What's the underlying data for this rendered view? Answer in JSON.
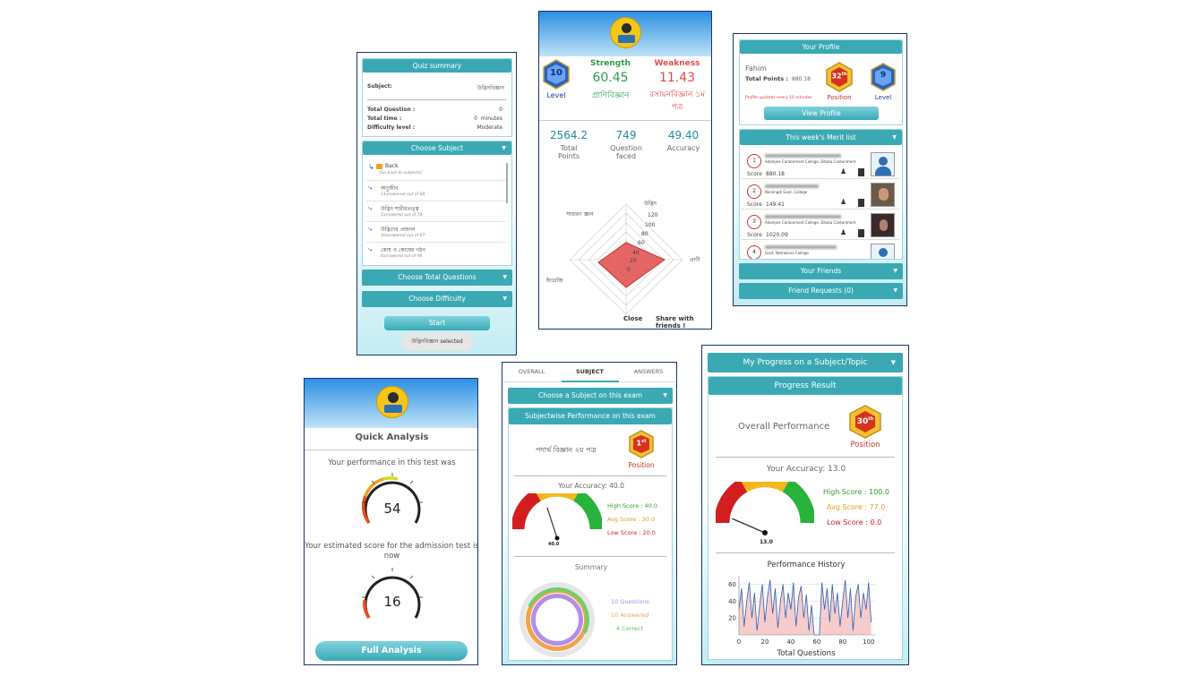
{
  "quiz": {
    "summary_title": "Quiz summary",
    "subject_label": "Subject:",
    "subject_value": "উদ্ভিদবিজ্ঞান",
    "total_question_label": "Total Question :",
    "total_question_value": "0",
    "total_time_label": "Total time :",
    "total_time_value": "0",
    "total_time_unit": "minutes",
    "difficulty_label": "Difficulty level :",
    "difficulty_value": "Moderate",
    "choose_subject": "Choose Subject",
    "topics": [
      {
        "name": "Back",
        "sub": "[Go back to subjects]"
      },
      {
        "name": "অণুজীব",
        "sub": "11answered out of 68"
      },
      {
        "name": "উদ্ভিদ শারীরতত্ত্ব",
        "sub": "5answered out of 74"
      },
      {
        "name": "উদ্ভিদের প্রজনন",
        "sub": "10answered out of 67"
      },
      {
        "name": "কোষ ও কোষের গঠন",
        "sub": "8answered out of 96"
      }
    ],
    "choose_total_questions": "Choose Total Questions",
    "choose_difficulty": "Choose Difficulty",
    "start": "Start",
    "selected_toast": "উদ্ভিদবিজ্ঞান selected"
  },
  "profile_stats": {
    "level_label": "Level",
    "level_value": "10",
    "strength_label": "Strength",
    "strength_value": "60.45",
    "strength_subject": "প্রাণিবিজ্ঞান",
    "weakness_label": "Weakness",
    "weakness_value": "11.43",
    "weakness_subject": "রসায়নবিজ্ঞান ১ম পত্র",
    "total_points_value": "2564.2",
    "total_points_label": "Total Points",
    "questions_faced_value": "749",
    "questions_faced_label": "Question faced",
    "accuracy_value": "49.40",
    "accuracy_label": "Accuracy",
    "radar_axes": [
      "উদ্ভিদ",
      "প্রাণী",
      "ইংরেজি",
      "সাধারণ জ্ঞান"
    ],
    "radar_ticks": [
      "120",
      "100",
      "80",
      "60",
      "40",
      "20",
      "0"
    ],
    "close": "Close",
    "share": "Share with friends !"
  },
  "your_profile": {
    "title": "Your Profile",
    "name": "Fahim",
    "points_label": "Total Points :",
    "points_value": "880.18",
    "position_value": "32",
    "position_suffix": "th",
    "position_label": "Position",
    "level_value": "9",
    "level_label": "Level",
    "update_note": "Profile updates every 10 minutes",
    "view_profile": "View Profile",
    "merit_title": "This week's Merit list",
    "merit": [
      {
        "rank": "1",
        "college": "Adamjee Cantonment College, Dhaka Cantonment",
        "score_label": "Score",
        "score": "880.18"
      },
      {
        "rank": "2",
        "college": "Narsingdi Govt. College",
        "score_label": "Score",
        "score": "149.41"
      },
      {
        "rank": "3",
        "college": "Adamjee Cantonment College, Dhaka Cantonment",
        "score_label": "Score",
        "score": "1020.09"
      },
      {
        "rank": "4",
        "college": "Govt. Netrokona College",
        "score_label": "Score",
        "score": ""
      }
    ],
    "your_friends": "Your Friends",
    "friend_requests": "Friend Requests (0)"
  },
  "quick": {
    "title": "Quick Analysis",
    "perf_text": "Your performance in this test was",
    "perf_value": "54",
    "est_text": "Your estimated score for the admission test is now",
    "est_value": "16",
    "full_analysis": "Full Analysis"
  },
  "subject_perf": {
    "tabs": [
      "OVERALL",
      "SUBJECT",
      "ANSWERS"
    ],
    "choose_subject": "Choose a Subject on this exam",
    "section_title": "Subjectwise Performance on this exam",
    "subject_name": "পদার্থ বিজ্ঞান ২য় পত্র",
    "position_value": "1",
    "position_suffix": "st",
    "position_label": "Position",
    "accuracy_text": "Your Accuracy: 40.0",
    "high_score": "High Score : 40.0",
    "avg_score": "Avg  Score : 30.0",
    "low_score": "Low  Score : 20.0",
    "needle_value": "40.0",
    "gauge_accuracy": 40,
    "summary_label": "Summary",
    "legend_questions": "10  Questions",
    "legend_answered": "10  Answered",
    "legend_correct": "4  Correct",
    "colors": {
      "questions": "#b48ee6",
      "answered": "#f0a24d",
      "correct": "#6ccf6c"
    }
  },
  "progress": {
    "dropdown": "My Progress on a Subject/Topic",
    "title": "Progress Result",
    "overall_label": "Overall Performance",
    "position_value": "30",
    "position_suffix": "th",
    "position_label": "Position",
    "accuracy_text": "Your Accuracy: 13.0",
    "high_score": "High Score : 100.0",
    "avg_score": "Avg  Score : 77.0",
    "low_score": "Low  Score : 0.0",
    "needle_value": "13.0",
    "gauge_accuracy": 13,
    "history_title": "Performance History",
    "xlabel": "Total Questions"
  },
  "chart_data": {
    "type": "line",
    "title": "Performance History",
    "xlabel": "Total Questions",
    "ylabel": "",
    "xlim": [
      0,
      105
    ],
    "ylim": [
      0,
      70
    ],
    "xticks": [
      0,
      20,
      40,
      60,
      80,
      100
    ],
    "yticks": [
      20,
      40,
      60
    ],
    "x": [
      0,
      2,
      4,
      6,
      8,
      10,
      12,
      14,
      16,
      18,
      20,
      22,
      24,
      26,
      28,
      30,
      32,
      34,
      36,
      38,
      40,
      42,
      44,
      46,
      48,
      50,
      52,
      54,
      56,
      58,
      60,
      62,
      64,
      66,
      68,
      70,
      72,
      74,
      76,
      78,
      80,
      82,
      84,
      86,
      88,
      90,
      92,
      94,
      96,
      98,
      100,
      102
    ],
    "values": [
      30,
      55,
      10,
      40,
      62,
      20,
      50,
      5,
      35,
      60,
      15,
      45,
      65,
      25,
      55,
      8,
      40,
      60,
      20,
      50,
      30,
      62,
      10,
      45,
      58,
      20,
      48,
      5,
      35,
      0,
      0,
      0,
      62,
      30,
      55,
      15,
      60,
      25,
      50,
      10,
      40,
      65,
      20,
      55,
      5,
      45,
      60,
      20,
      50,
      30,
      62,
      15
    ]
  }
}
